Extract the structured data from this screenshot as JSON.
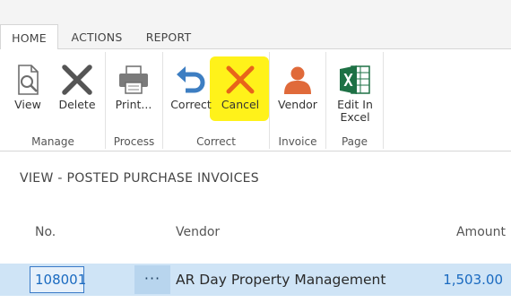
{
  "tabs": [
    {
      "label": "HOME"
    },
    {
      "label": "ACTIONS"
    },
    {
      "label": "REPORT"
    }
  ],
  "active_tab": "HOME",
  "ribbon": {
    "buttons": [
      {
        "label": "View",
        "icon": "view-document-icon"
      },
      {
        "label": "Delete",
        "icon": "delete-x-icon"
      },
      {
        "label": "Print...",
        "icon": "printer-icon"
      },
      {
        "label": "Correct",
        "icon": "undo-arrow-icon"
      },
      {
        "label": "Cancel",
        "icon": "cancel-x-icon"
      },
      {
        "label": "Vendor",
        "icon": "person-icon"
      },
      {
        "label": "Edit In",
        "label2": "Excel",
        "icon": "excel-icon"
      }
    ],
    "groups": [
      {
        "label": "Manage"
      },
      {
        "label": "Process"
      },
      {
        "label": "Correct"
      },
      {
        "label": "Invoice"
      },
      {
        "label": "Page"
      }
    ],
    "highlight_color": "#fff21a"
  },
  "page": {
    "title": "VIEW - POSTED PURCHASE INVOICES"
  },
  "table": {
    "headers": {
      "no": "No.",
      "vendor": "Vendor",
      "amount": "Amount"
    },
    "rows": [
      {
        "no": "108001",
        "actions": "···",
        "vendor": "AR Day Property Management",
        "amount": "1,503.00"
      }
    ]
  },
  "colors": {
    "link_blue": "#1a6ac0",
    "row_selected": "#cfe4f6",
    "delete_gray": "#555555",
    "cancel_orange": "#e8651a",
    "correct_blue": "#3d7ec2",
    "vendor_orange": "#e06a3a",
    "excel_green": "#1e7145"
  }
}
